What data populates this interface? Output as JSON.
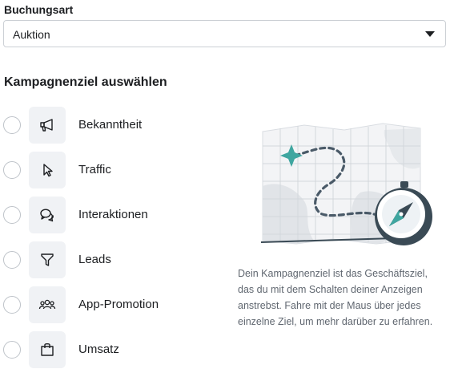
{
  "booking": {
    "label": "Buchungsart",
    "selected": "Auktion"
  },
  "objectives": {
    "title": "Kampagnenziel auswählen",
    "items": [
      {
        "label": "Bekanntheit",
        "icon": "megaphone-icon"
      },
      {
        "label": "Traffic",
        "icon": "cursor-icon"
      },
      {
        "label": "Interaktionen",
        "icon": "chat-bubbles-icon"
      },
      {
        "label": "Leads",
        "icon": "funnel-icon"
      },
      {
        "label": "App-Promotion",
        "icon": "people-group-icon"
      },
      {
        "label": "Umsatz",
        "icon": "shopping-bag-icon"
      }
    ],
    "description": "Dein Kampagnenziel ist das Geschäftsziel, das du mit dem Schalten deiner Anzeigen anstrebst. Fahre mit der Maus über jedes einzelne Ziel, um mehr darüber zu erfahren."
  },
  "colors": {
    "accent_teal": "#3fa6a0",
    "compass_dark": "#3a4a55"
  }
}
